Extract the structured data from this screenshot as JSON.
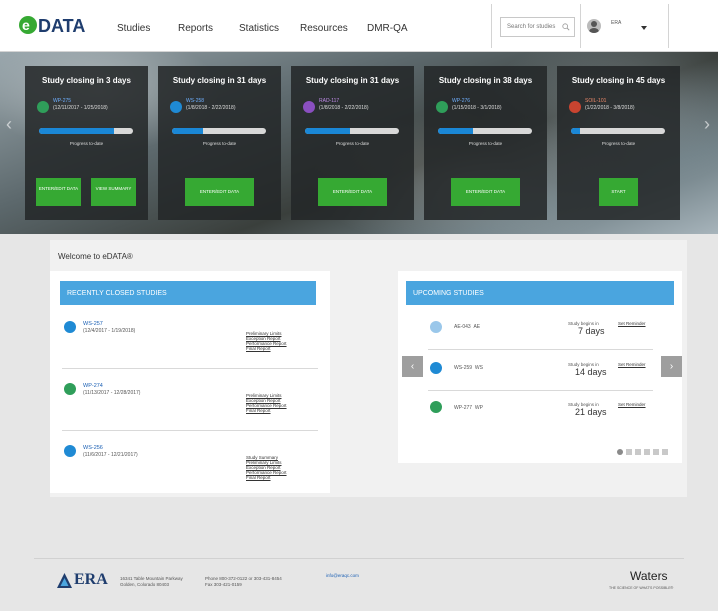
{
  "brand": {
    "logo_text": "DATA",
    "logo_e": "e"
  },
  "nav": [
    "Studies",
    "Reports",
    "Statistics",
    "Resources",
    "DMR-QA"
  ],
  "search": {
    "placeholder": "Search for studies"
  },
  "user": {
    "name": "ERA"
  },
  "colors": {
    "accent": "#4aa5df",
    "button_green": "#36a933",
    "progress_blue": "#1a87d6",
    "footer_brand": "#1f3d6e"
  },
  "hero_cards": [
    {
      "title": "Study closing in 3 days",
      "code": "WP-275",
      "dates": "(12/11/2017 - 1/25/2018)",
      "progress": 0.8,
      "progress_label": "Progress to-date",
      "icon": "green-leaf-icon",
      "buttons": [
        "ENTER/EDIT DATA",
        "VIEW SUMMARY"
      ]
    },
    {
      "title": "Study closing in 31 days",
      "code": "WS-258",
      "dates": "(1/8/2018 - 2/22/2018)",
      "progress": 0.33,
      "progress_label": "Progress to-date",
      "icon": "blue-drop-icon",
      "buttons": [
        "ENTER/EDIT DATA"
      ]
    },
    {
      "title": "Study closing in 31 days",
      "code": "RAD-117",
      "dates": "(1/8/2018 - 2/22/2018)",
      "progress": 0.48,
      "progress_label": "Progress to-date",
      "icon": "radiation-icon",
      "buttons": [
        "ENTER/EDIT DATA"
      ]
    },
    {
      "title": "Study closing in 38 days",
      "code": "WP-276",
      "dates": "(1/15/2018 - 3/1/2018)",
      "progress": 0.37,
      "progress_label": "Progress to-date",
      "icon": "green-leaf-icon",
      "buttons": [
        "ENTER/EDIT DATA"
      ]
    },
    {
      "title": "Study closing in 45 days",
      "code": "SOIL-101",
      "dates": "(1/22/2018 - 3/8/2018)",
      "progress": 0.1,
      "progress_label": "Progress to-date",
      "icon": "soil-icon",
      "buttons": [
        "START"
      ]
    }
  ],
  "welcome": "Welcome to eDATA®",
  "recent": {
    "heading": "RECENTLY CLOSED STUDIES",
    "items": [
      {
        "code": "WS-257",
        "dates": "(12/4/2017 - 1/19/2018)",
        "links": [
          "Preliminary Limits",
          "Exception Report",
          "Performance Report",
          "Final Report"
        ]
      },
      {
        "code": "WP-274",
        "dates": "(11/13/2017 - 12/28/2017)",
        "links": [
          "Preliminary Limits",
          "Exception Report",
          "Performance Report",
          "Final Report"
        ]
      },
      {
        "code": "WS-256",
        "dates": "(11/6/2017 - 12/21/2017)",
        "links": [
          "Study Summary",
          "Preliminary Limits",
          "Exception Report",
          "Performance Report",
          "Final Report"
        ]
      }
    ]
  },
  "upcoming": {
    "heading": "UPCOMING STUDIES",
    "items": [
      {
        "code": "AE-043",
        "type": "AE",
        "begins": "Study begins in",
        "days": "7 days",
        "reminder": "Set Reminder"
      },
      {
        "code": "WS-259",
        "type": "WS",
        "begins": "Study begins in",
        "days": "14 days",
        "reminder": "Set Reminder"
      },
      {
        "code": "WP-277",
        "type": "WP",
        "begins": "Study begins in",
        "days": "21 days",
        "reminder": "Set Reminder"
      }
    ]
  },
  "footer": {
    "logo": "ERA",
    "address1": "16341 Table Mountain Parkway",
    "address2": "Golden, Colorado 80403",
    "phone": "Phone 800-372-0122 or 303-431-8454",
    "fax": "Fax 303-421-0159",
    "email": "info@eraqc.com",
    "partner": "Waters",
    "partner_tag": "THE SCIENCE OF WHAT'S POSSIBLE®"
  }
}
